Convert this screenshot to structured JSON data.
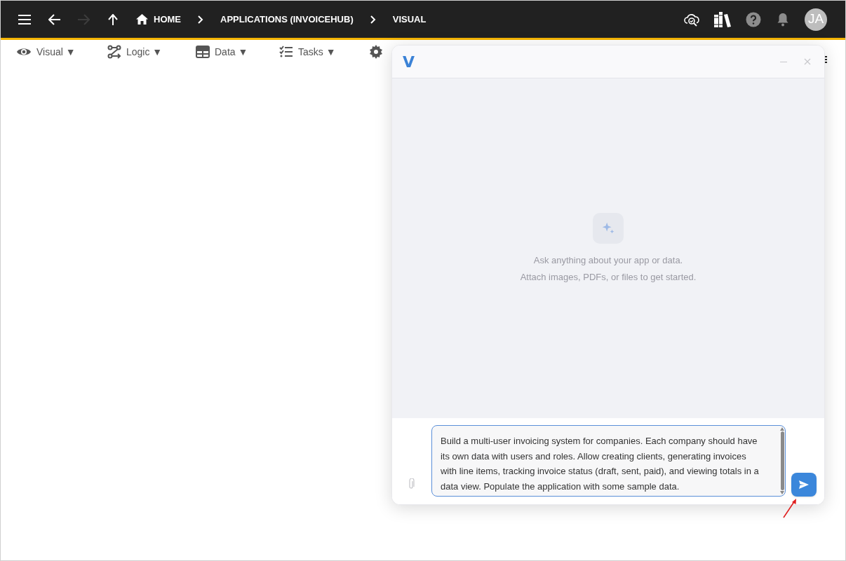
{
  "top_bar": {
    "breadcrumbs": [
      {
        "label": "HOME",
        "kind": "home"
      },
      {
        "label": "APPLICATIONS (INVOICEHUB)",
        "kind": "plain"
      },
      {
        "label": "VISUAL",
        "kind": "plain"
      }
    ],
    "forward_disabled": true,
    "avatar": "JA"
  },
  "toolbar": {
    "tabs": [
      {
        "label": "Visual ▼",
        "kind": "eye"
      },
      {
        "label": "Logic ▼",
        "kind": "flow"
      },
      {
        "label": "Data ▼",
        "kind": "table"
      },
      {
        "label": "Tasks ▼",
        "kind": "checklist"
      },
      {
        "kind": "gear"
      }
    ]
  },
  "assistant": {
    "logo": "V",
    "empty_text": [
      "Ask anything about your app or data.",
      "Attach images, PDFs, or files to get started."
    ],
    "message": "Build a multi-user invoicing system for companies. Each company should have its own data with users and roles. Allow creating clients, generating invoices with line items, tracking invoice status (draft, sent, paid), and viewing totals in a data view. Populate the application with some sample data."
  }
}
